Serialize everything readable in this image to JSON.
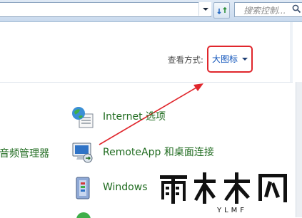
{
  "toolbar": {
    "search_placeholder": "搜索控制..."
  },
  "view": {
    "label": "查看方式:",
    "selected": "大图标"
  },
  "items": [
    {
      "label": "Internet 选项"
    },
    {
      "label": "RemoteApp 和桌面连接"
    },
    {
      "label": "Windows"
    }
  ],
  "left_partial_item": "音频管理器",
  "watermark": {
    "text": "雨林木风",
    "sub": "YLMF"
  },
  "colors": {
    "accent_link": "#1155bb",
    "item_text": "#1f6b1f",
    "highlight": "#e0262c"
  }
}
